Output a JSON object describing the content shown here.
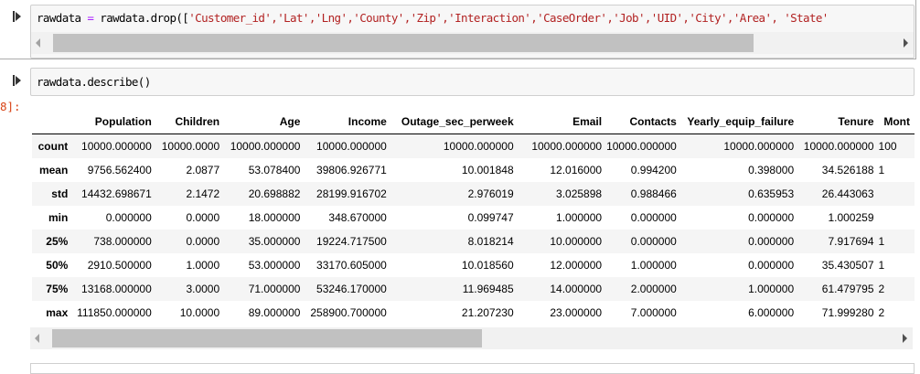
{
  "cell1": {
    "code_parts": {
      "a": "rawdata ",
      "op": "=",
      "b": " rawdata.drop([",
      "strings": "'Customer_id','Lat','Lng','County','Zip','Interaction','CaseOrder','Job','UID','City','Area', 'State'"
    }
  },
  "cell2": {
    "code": "rawdata.describe()",
    "out_prompt": "8]:"
  },
  "table": {
    "columns": [
      "Population",
      "Children",
      "Age",
      "Income",
      "Outage_sec_perweek",
      "Email",
      "Contacts",
      "Yearly_equip_failure",
      "Tenure",
      "Mont"
    ],
    "rows": [
      {
        "label": "count",
        "values": [
          "10000.000000",
          "10000.0000",
          "10000.000000",
          "10000.000000",
          "10000.000000",
          "10000.000000",
          "10000.000000",
          "10000.000000",
          "10000.000000",
          "100"
        ]
      },
      {
        "label": "mean",
        "values": [
          "9756.562400",
          "2.0877",
          "53.078400",
          "39806.926771",
          "10.001848",
          "12.016000",
          "0.994200",
          "0.398000",
          "34.526188",
          "1"
        ]
      },
      {
        "label": "std",
        "values": [
          "14432.698671",
          "2.1472",
          "20.698882",
          "28199.916702",
          "2.976019",
          "3.025898",
          "0.988466",
          "0.635953",
          "26.443063",
          ""
        ]
      },
      {
        "label": "min",
        "values": [
          "0.000000",
          "0.0000",
          "18.000000",
          "348.670000",
          "0.099747",
          "1.000000",
          "0.000000",
          "0.000000",
          "1.000259",
          ""
        ]
      },
      {
        "label": "25%",
        "values": [
          "738.000000",
          "0.0000",
          "35.000000",
          "19224.717500",
          "8.018214",
          "10.000000",
          "0.000000",
          "0.000000",
          "7.917694",
          "1"
        ]
      },
      {
        "label": "50%",
        "values": [
          "2910.500000",
          "1.0000",
          "53.000000",
          "33170.605000",
          "10.018560",
          "12.000000",
          "1.000000",
          "0.000000",
          "35.430507",
          "1"
        ]
      },
      {
        "label": "75%",
        "values": [
          "13168.000000",
          "3.0000",
          "71.000000",
          "53246.170000",
          "11.969485",
          "14.000000",
          "2.000000",
          "1.000000",
          "61.479795",
          "2"
        ]
      },
      {
        "label": "max",
        "values": [
          "111850.000000",
          "10.0000",
          "89.000000",
          "258900.700000",
          "21.207230",
          "23.000000",
          "7.000000",
          "6.000000",
          "71.999280",
          "2"
        ]
      }
    ]
  }
}
